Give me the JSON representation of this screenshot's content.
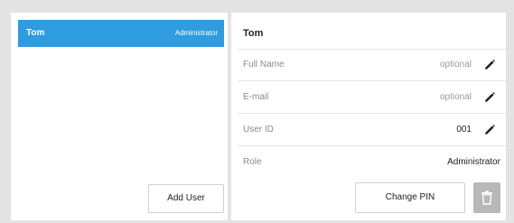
{
  "users": [
    {
      "name": "Tom",
      "role": "Administrator"
    }
  ],
  "left": {
    "add_user_label": "Add User"
  },
  "detail": {
    "title": "Tom",
    "fields": [
      {
        "label": "Full Name",
        "value": "optional",
        "editable": true
      },
      {
        "label": "E-mail",
        "value": "optional",
        "editable": true
      },
      {
        "label": "User ID",
        "value": "001",
        "editable": true
      },
      {
        "label": "Role",
        "value": "Administrator",
        "editable": false
      }
    ],
    "change_pin_label": "Change PIN"
  },
  "icons": {
    "edit": "pencil-icon",
    "delete": "trash-icon"
  },
  "colors": {
    "accent": "#2f9be0",
    "background": "#e3e3e3",
    "delete_button": "#b8b8b8"
  }
}
